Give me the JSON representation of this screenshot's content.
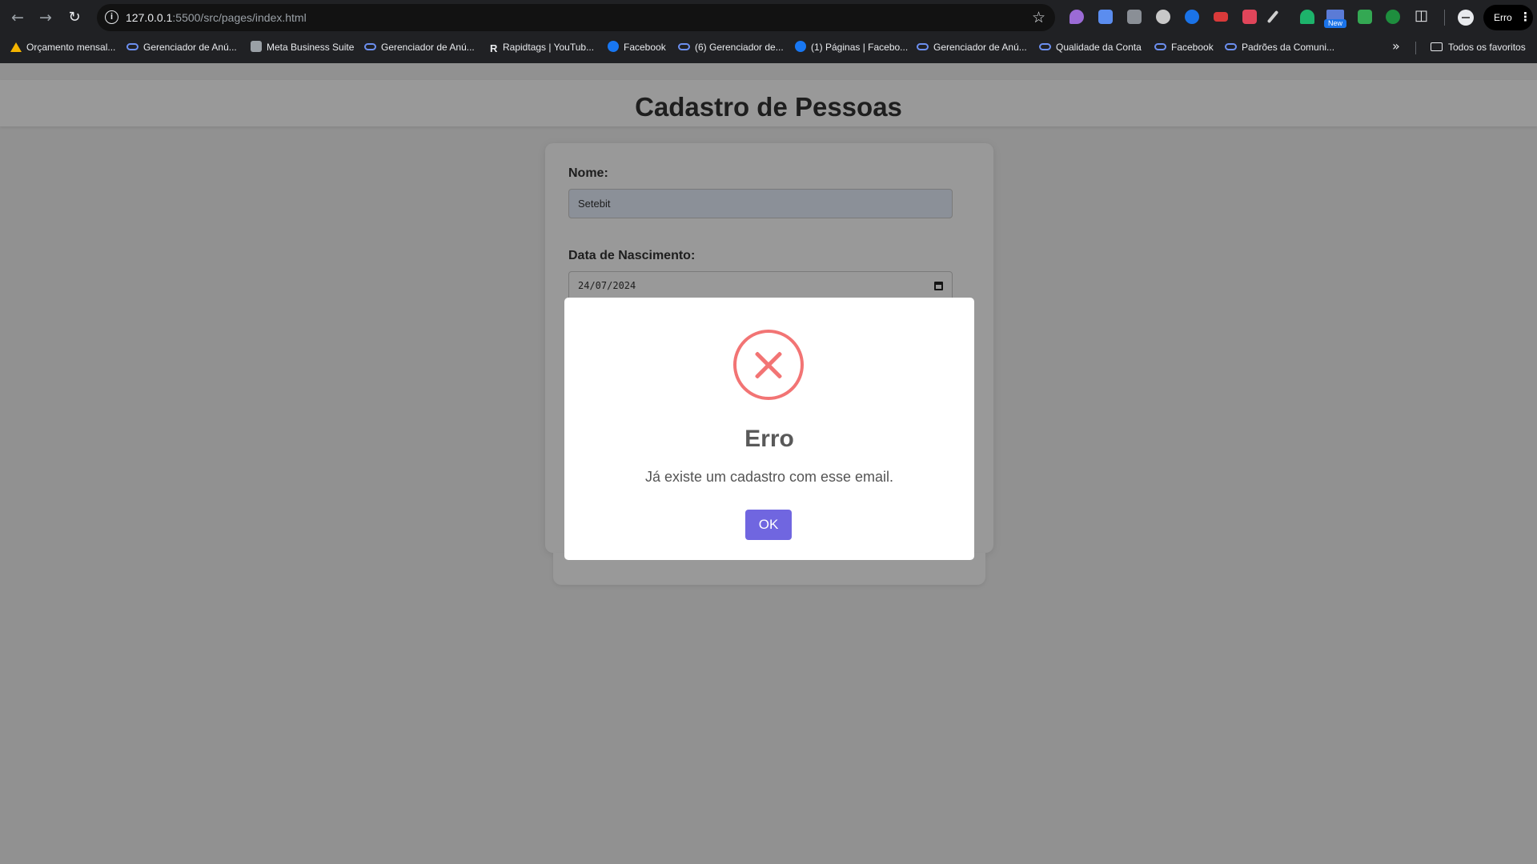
{
  "browser": {
    "url_host": "127.0.0.1",
    "url_rest": ":5500/src/pages/index.html",
    "profile_chip_label": "Erro",
    "extension_badge": "New",
    "bookmarks": [
      {
        "label": "Orçamento mensal...",
        "icon": "drive-icon"
      },
      {
        "label": "Gerenciador de Anú...",
        "icon": "meta-icon"
      },
      {
        "label": "Meta Business Suite",
        "icon": "suite-icon"
      },
      {
        "label": "Gerenciador de Anú...",
        "icon": "meta-icon"
      },
      {
        "label": "Rapidtags | YouTub...",
        "icon": "r-icon"
      },
      {
        "label": "Facebook",
        "icon": "facebook-icon"
      },
      {
        "label": "(6) Gerenciador de...",
        "icon": "meta-icon"
      },
      {
        "label": "(1) Páginas | Facebo...",
        "icon": "facebook-icon"
      },
      {
        "label": "Gerenciador de Anú...",
        "icon": "meta-icon"
      },
      {
        "label": "Qualidade da Conta",
        "icon": "meta-icon"
      },
      {
        "label": "Facebook",
        "icon": "meta-icon"
      },
      {
        "label": "Padrões da Comuni...",
        "icon": "meta-icon"
      }
    ],
    "all_bookmarks_label": "Todos os favoritos"
  },
  "page": {
    "title": "Cadastro de Pessoas",
    "form": {
      "name_label": "Nome:",
      "name_value": "Setebit",
      "birth_label": "Data de Nascimento:",
      "birth_value": "24/07/2024"
    }
  },
  "modal": {
    "title": "Erro",
    "message": "Já existe um cadastro com esse email.",
    "ok_label": "OK",
    "icon": "error-x-icon",
    "colors": {
      "icon": "#f27474",
      "button": "#7066e0"
    }
  }
}
